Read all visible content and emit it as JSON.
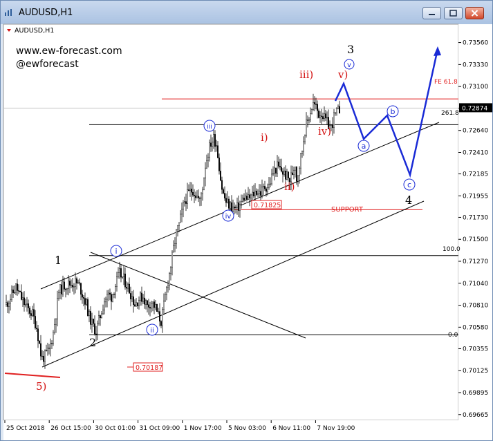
{
  "window": {
    "title": "AUDUSD,H1"
  },
  "chart_label": "AUDUSD,H1",
  "watermark": {
    "site": "www.ew-forecast.com",
    "handle": "@ewforecast"
  },
  "colors": {
    "grid": "#e6e6e6",
    "candles": "#000000",
    "red": "#e02020",
    "blue": "#1a2bd6",
    "bg": "#ffffff"
  },
  "chart_data": {
    "type": "candlestick",
    "y_axis": {
      "ylim": [
        0.6962,
        0.7368
      ],
      "ticks": [
        "0.73560",
        "0.73330",
        "0.73100",
        "0.72874",
        "0.72640",
        "0.72410",
        "0.72185",
        "0.71955",
        "0.71730",
        "0.71500",
        "0.71270",
        "0.71040",
        "0.70810",
        "0.70580",
        "0.70355",
        "0.70125",
        "0.69895",
        "0.69665"
      ]
    },
    "x_axis": {
      "ticks": [
        "25 Oct 2018",
        "26 Oct 15:00",
        "30 Oct 01:00",
        "31 Oct 09:00",
        "1 Nov 17:00",
        "5 Nov 03:00",
        "6 Nov 11:00",
        "7 Nov 19:00"
      ]
    },
    "current_price": "0.72874",
    "price_path": [
      [
        0,
        0.7082
      ],
      [
        6,
        0.7089
      ],
      [
        14,
        0.71
      ],
      [
        22,
        0.7088
      ],
      [
        30,
        0.7078
      ],
      [
        38,
        0.7072
      ],
      [
        44,
        0.7058
      ],
      [
        48,
        0.704
      ],
      [
        51,
        0.7025
      ],
      [
        56,
        0.7028
      ],
      [
        62,
        0.7034
      ],
      [
        68,
        0.7052
      ],
      [
        72,
        0.7072
      ],
      [
        76,
        0.7095
      ],
      [
        84,
        0.7102
      ],
      [
        92,
        0.7103
      ],
      [
        100,
        0.7105
      ],
      [
        106,
        0.7101
      ],
      [
        110,
        0.7093
      ],
      [
        116,
        0.7082
      ],
      [
        120,
        0.7069
      ],
      [
        125,
        0.706
      ],
      [
        130,
        0.7054
      ],
      [
        136,
        0.707
      ],
      [
        142,
        0.7086
      ],
      [
        148,
        0.7092
      ],
      [
        152,
        0.709
      ],
      [
        158,
        0.7102
      ],
      [
        164,
        0.7114
      ],
      [
        170,
        0.7108
      ],
      [
        176,
        0.71
      ],
      [
        182,
        0.709
      ],
      [
        186,
        0.7082
      ],
      [
        192,
        0.7088
      ],
      [
        198,
        0.709
      ],
      [
        204,
        0.708
      ],
      [
        210,
        0.7085
      ],
      [
        216,
        0.7078
      ],
      [
        220,
        0.707
      ],
      [
        224,
        0.7064
      ],
      [
        228,
        0.708
      ],
      [
        233,
        0.7103
      ],
      [
        238,
        0.7122
      ],
      [
        242,
        0.714
      ],
      [
        246,
        0.7156
      ],
      [
        250,
        0.7165
      ],
      [
        254,
        0.7178
      ],
      [
        258,
        0.719
      ],
      [
        262,
        0.7196
      ],
      [
        266,
        0.72
      ],
      [
        270,
        0.7202
      ],
      [
        275,
        0.7196
      ],
      [
        280,
        0.719
      ],
      [
        284,
        0.7205
      ],
      [
        288,
        0.7228
      ],
      [
        292,
        0.7241
      ],
      [
        296,
        0.7251
      ],
      [
        300,
        0.7256
      ],
      [
        304,
        0.725
      ],
      [
        307,
        0.7233
      ],
      [
        310,
        0.7214
      ],
      [
        313,
        0.7199
      ],
      [
        318,
        0.7189
      ],
      [
        324,
        0.7185
      ],
      [
        328,
        0.7183
      ],
      [
        333,
        0.7182
      ],
      [
        338,
        0.7186
      ],
      [
        344,
        0.7194
      ],
      [
        350,
        0.7192
      ],
      [
        356,
        0.7196
      ],
      [
        362,
        0.7201
      ],
      [
        368,
        0.7199
      ],
      [
        374,
        0.7205
      ],
      [
        380,
        0.7206
      ],
      [
        386,
        0.722
      ],
      [
        392,
        0.7226
      ],
      [
        398,
        0.7222
      ],
      [
        404,
        0.7217
      ],
      [
        410,
        0.7212
      ],
      [
        414,
        0.722
      ],
      [
        418,
        0.723
      ],
      [
        420,
        0.7213
      ],
      [
        424,
        0.7228
      ],
      [
        428,
        0.7244
      ],
      [
        430,
        0.7255
      ],
      [
        432,
        0.7265
      ],
      [
        436,
        0.7274
      ],
      [
        440,
        0.7284
      ],
      [
        444,
        0.7292
      ],
      [
        448,
        0.7288
      ],
      [
        452,
        0.7281
      ],
      [
        456,
        0.7283
      ],
      [
        460,
        0.7276
      ],
      [
        466,
        0.727
      ],
      [
        470,
        0.7267
      ],
      [
        474,
        0.7278
      ],
      [
        478,
        0.7282
      ],
      [
        482,
        0.7286
      ]
    ]
  },
  "levels": {
    "fe618": {
      "label": "FE 61.8",
      "value": 0.7297
    },
    "l2618": {
      "label": "261.8",
      "value": 0.727
    },
    "l100": {
      "label": "100.0",
      "value": 0.7133
    },
    "l0": {
      "label": "0.0",
      "value": 0.705
    },
    "support": {
      "label": "SUPPORT",
      "price": "0.71825",
      "value": 0.7181
    },
    "low_box": "0.70187"
  },
  "wave_labels": {
    "w1": "1",
    "w2": "2",
    "w3": "3",
    "w4": "4",
    "w5": "5)",
    "i_small": "i",
    "ii_small": "ii",
    "iii_small": "iii",
    "iv_small": "iv",
    "v_small": "v",
    "a_small": "a",
    "b_small": "b",
    "c_small": "c",
    "i_red": "i)",
    "ii_red": "ii)",
    "iii_red": "iii)",
    "iv_red": "iv)",
    "v_red": "v)"
  }
}
